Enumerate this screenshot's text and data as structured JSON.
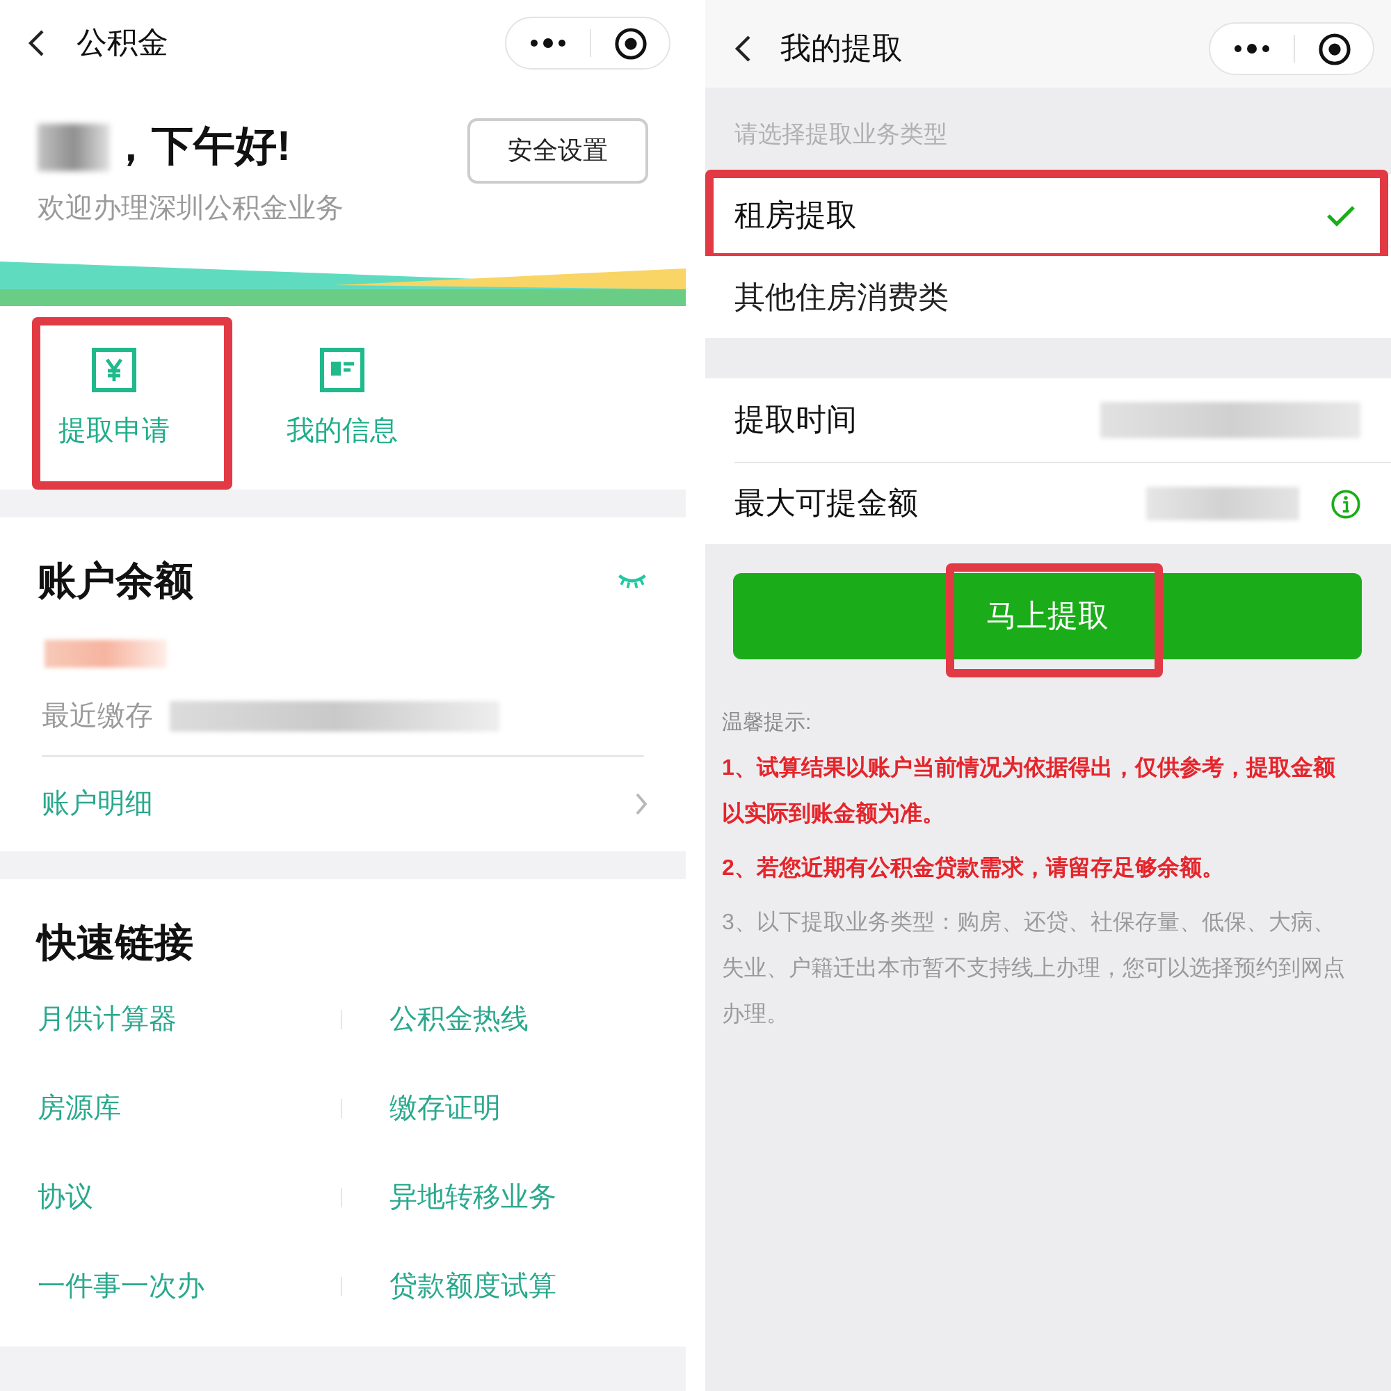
{
  "home_screen": {
    "title": "公积金",
    "greeting": "，下午好!",
    "security_button": "安全设置",
    "welcome": "欢迎办理深圳公积金业务",
    "shortcuts": [
      {
        "label": "提取申请",
        "highlighted": true
      },
      {
        "label": "我的信息",
        "highlighted": false
      }
    ],
    "balance_card": {
      "title": "账户余额",
      "recent_deposit_label": "最近缴存",
      "detail_link": "账户明细"
    },
    "quick_links": {
      "title": "快速链接",
      "links": [
        "月供计算器",
        "公积金热线",
        "房源库",
        "缴存证明",
        "协议",
        "异地转移业务",
        "一件事一次办",
        "贷款额度试算"
      ]
    }
  },
  "withdraw_screen": {
    "title": "我的提取",
    "prompt": "请选择提取业务类型",
    "types": [
      {
        "label": "租房提取",
        "selected": true,
        "highlighted": true
      },
      {
        "label": "其他住房消费类",
        "selected": false,
        "highlighted": false
      }
    ],
    "fields": [
      {
        "label": "提取时间",
        "kind": "plain"
      },
      {
        "label": "最大可提金额",
        "kind": "with_info"
      }
    ],
    "withdraw_button": {
      "label": "马上提取",
      "highlighted": true
    },
    "tips": {
      "title": "温馨提示:",
      "items": [
        {
          "kind": "warning",
          "text": "1、试算结果以账户当前情况为依据得出，仅供参考，提取金额以实际到账金额为准。"
        },
        {
          "kind": "warning",
          "text": "2、若您近期有公积金贷款需求，请留存足够余额。"
        },
        {
          "kind": "note",
          "text": "3、以下提取业务类型：购房、还贷、社保存量、低保、大病、失业、户籍迁出本市暂不支持线上办理，您可以选择预约到网点办理。"
        }
      ]
    }
  }
}
